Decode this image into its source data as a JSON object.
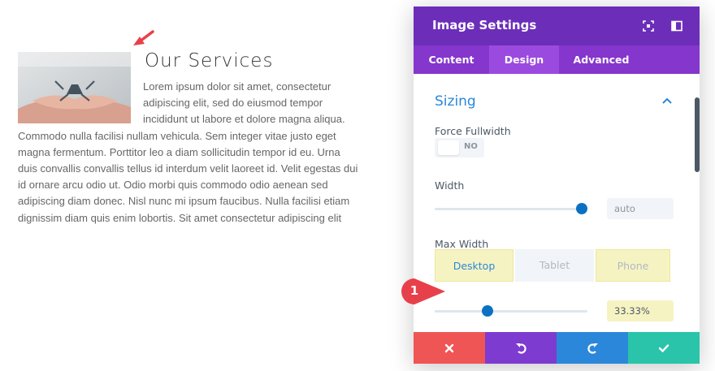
{
  "content": {
    "title": "Our Services",
    "paragraph": "Lorem ipsum dolor sit amet, consectetur adipiscing elit, sed do eiusmod tempor incididunt ut labore et dolore magna aliqua. Commodo nulla facilisi nullam vehicula. Sem integer vitae justo eget magna fermentum. Porttitor leo a diam sollicitudin tempor id eu. Urna duis convallis convallis tellus id interdum velit laoreet id. Velit egestas dui id ornare arcu odio ut. Odio morbi quis commodo odio aenean sed adipiscing diam donec. Nisl nunc mi ipsum faucibus. Nulla facilisi etiam dignissim diam quis enim lobortis. Sit amet consectetur adipiscing elit"
  },
  "panel": {
    "title": "Image Settings",
    "tabs": [
      {
        "label": "Content",
        "active": false
      },
      {
        "label": "Design",
        "active": true
      },
      {
        "label": "Advanced",
        "active": false
      }
    ],
    "section": {
      "title": "Sizing",
      "force_fullwidth": {
        "label": "Force Fullwidth",
        "toggle_text": "NO",
        "enabled": false
      },
      "width": {
        "label": "Width",
        "value": "auto",
        "slider_fraction": 1.0
      },
      "max_width": {
        "label": "Max Width",
        "devices": [
          "Desktop",
          "Tablet",
          "Phone"
        ],
        "active_device": "Desktop",
        "value": "33.33%",
        "slider_fraction": 0.3333
      }
    }
  },
  "annotations": {
    "callout_number": "1"
  },
  "colors": {
    "header": "#6c2eb9",
    "tabs_bar": "#8536cc",
    "active_tab": "#9b4ae0",
    "accent_blue": "#2b87da",
    "slider_handle": "#0c71c3",
    "highlight": "#f6f3c3",
    "cancel": "#ef5555",
    "undo": "#7e3bd0",
    "redo": "#2b87da",
    "save": "#29c4a9",
    "annotation": "#e8404a"
  },
  "icons": {
    "expand": "expand-icon",
    "split": "split-view-icon",
    "chevron": "chevron-up-icon",
    "cancel": "close-icon",
    "undo": "undo-icon",
    "redo": "redo-icon",
    "save": "check-icon"
  }
}
